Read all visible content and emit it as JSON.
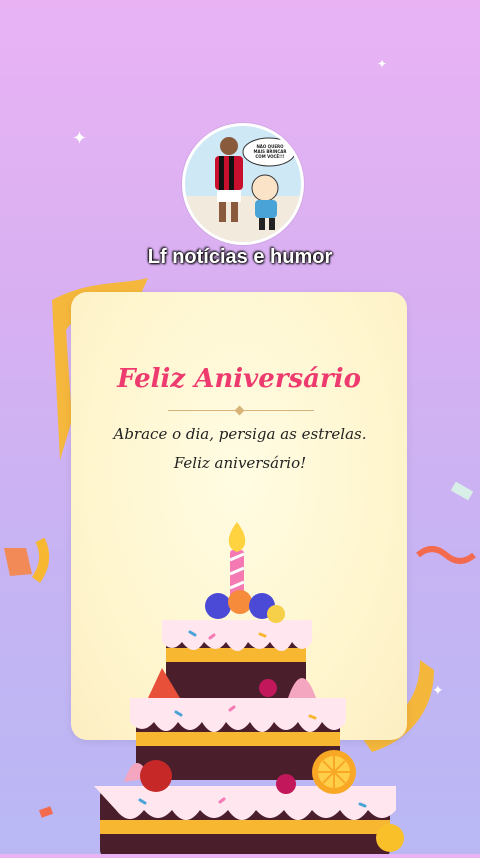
{
  "channel": {
    "name": "Lf notícias e humor"
  },
  "avatar": {
    "speech_text": "NÃO QUERO MAIS BRINCAR COM VOCÊ!!!"
  },
  "card": {
    "title": "Feliz Aniversário",
    "message": "Abrace o dia, persiga as estrelas. Feliz aniversário!"
  },
  "colors": {
    "title": "#ee3b6f",
    "background_top": "#e9b3f4",
    "background_bottom": "#b9b8f5",
    "card": "#fff6cf"
  }
}
